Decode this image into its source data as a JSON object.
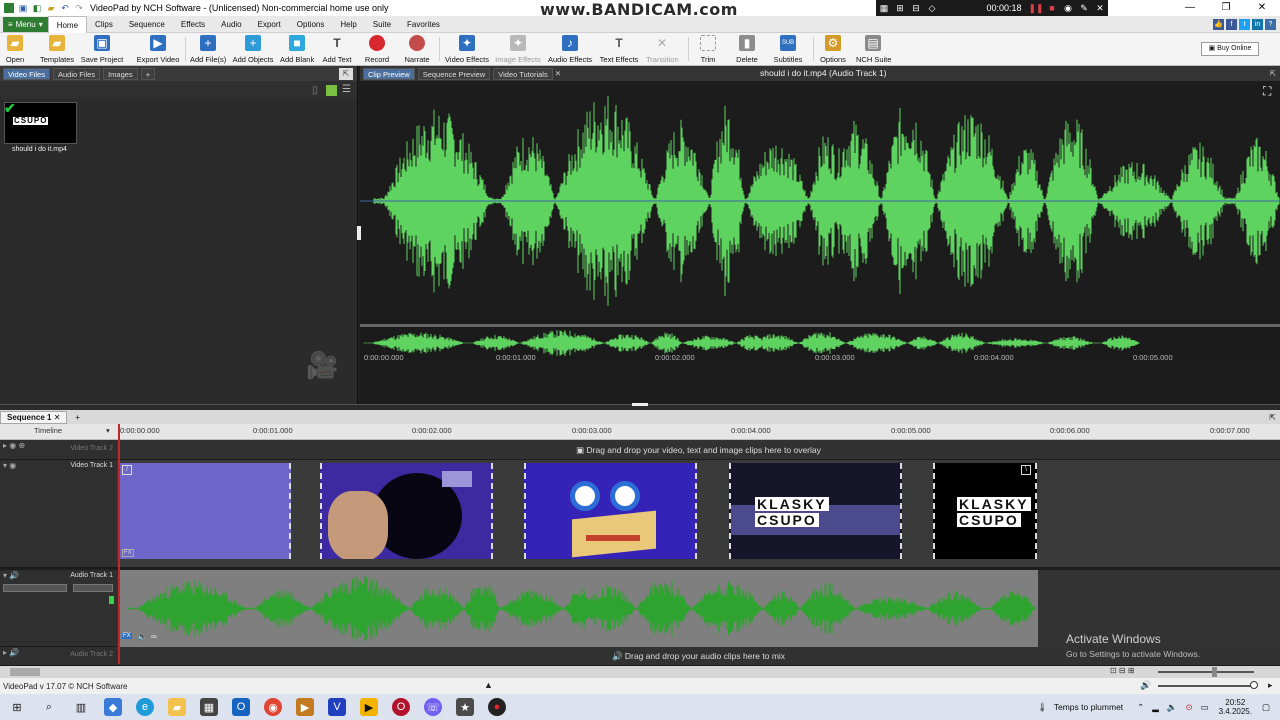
{
  "window": {
    "title": "VideoPad by NCH Software - (Unlicensed) Non-commercial home use only",
    "watermark": "www.BANDICAM.com",
    "recording_time": "00:00:18"
  },
  "menu": {
    "menu_button": "Menu",
    "items": [
      "Home",
      "Clips",
      "Sequence",
      "Effects",
      "Audio",
      "Export",
      "Options",
      "Help",
      "Suite",
      "Favorites"
    ],
    "active": "Home"
  },
  "toolbar": {
    "buttons": [
      {
        "label": "Open",
        "icon": "folder-open-icon"
      },
      {
        "label": "Templates",
        "icon": "templates-icon"
      },
      {
        "label": "Save Project",
        "icon": "save-icon"
      },
      {
        "label": "Export Video",
        "icon": "export-video-icon"
      },
      {
        "label": "Add File(s)",
        "icon": "add-files-icon"
      },
      {
        "label": "Add Objects",
        "icon": "add-objects-icon"
      },
      {
        "label": "Add Blank",
        "icon": "add-blank-icon"
      },
      {
        "label": "Add Text",
        "icon": "text-icon"
      },
      {
        "label": "Record",
        "icon": "record-icon"
      },
      {
        "label": "Narrate",
        "icon": "microphone-icon"
      },
      {
        "label": "Video Effects",
        "icon": "video-effects-icon"
      },
      {
        "label": "Image Effects",
        "icon": "image-effects-icon"
      },
      {
        "label": "Audio Effects",
        "icon": "audio-effects-icon"
      },
      {
        "label": "Text Effects",
        "icon": "text-effects-icon"
      },
      {
        "label": "Transition",
        "icon": "transition-icon"
      },
      {
        "label": "Trim",
        "icon": "trim-icon"
      },
      {
        "label": "Delete",
        "icon": "trash-icon"
      },
      {
        "label": "Subtitles",
        "icon": "subtitles-icon"
      },
      {
        "label": "Options",
        "icon": "options-icon"
      },
      {
        "label": "NCH Suite",
        "icon": "nch-suite-icon"
      }
    ],
    "buy_online": "Buy Online"
  },
  "bin": {
    "tabs": [
      "Video Files",
      "Audio Files",
      "Images",
      "+"
    ],
    "active_tab": "Video Files",
    "clips": [
      {
        "name": "should i do it.mp4"
      }
    ]
  },
  "preview": {
    "tabs": [
      "Clip Preview",
      "Sequence Preview",
      "Video Tutorials"
    ],
    "active_tab": "Clip Preview",
    "title": "should i do it.mp4 (Audio Track 1)",
    "ruler": [
      "0:00:00.000",
      "0:00:01.000",
      "0:00:02.000",
      "0:00:03.000",
      "0:00:04.000",
      "0:00:05.000"
    ]
  },
  "sequence": {
    "tab": "Sequence 1",
    "timeline_label": "Timeline",
    "ruler": [
      "0:00:00.000",
      "0:00:01.000",
      "0:00:02.000",
      "0:00:03.000",
      "0:00:04.000",
      "0:00:05.000",
      "0:00:06.000",
      "0:00:07.000"
    ],
    "tracks": {
      "video2": "Video Track 2",
      "video1": "Video Track 1",
      "audio1": "Audio Track 1",
      "audio2": "Audio Track 2"
    },
    "overlay_hint": "Drag and drop your video, text and image clips here to overlay",
    "audio_hint": "Drag and drop your audio clips here to mix",
    "clip_texts": {
      "row1": "KLASKY",
      "row2": "CSUPO"
    }
  },
  "activation": {
    "title": "Activate Windows",
    "subtitle": "Go to Settings to activate Windows."
  },
  "status": {
    "version": "VideoPad v 17.07 © NCH Software"
  },
  "taskbar": {
    "weather": "Temps to plummet",
    "time": "20:52",
    "date": "3.4.2025."
  },
  "colors": {
    "waveform": "#5fd35f",
    "waveform_timeline": "#2fa32f",
    "accent_blue": "#4a6f9c",
    "menu_green": "#2f7d32",
    "playhead": "#c0262c"
  }
}
